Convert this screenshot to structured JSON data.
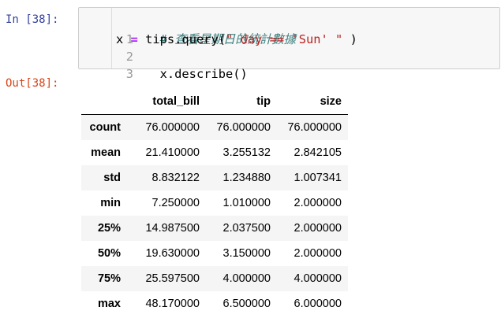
{
  "input_prompt": "In [38]:",
  "output_prompt": "Out[38]:",
  "code": {
    "line_numbers": [
      "1",
      "2",
      "3"
    ],
    "line1_comment": "# 查看星期日的統計數據",
    "line2_var": "x",
    "line2_eq": " = ",
    "line2_call": "tips.query(",
    "line2_string": "\" day == 'Sun' \"",
    "line2_close": " )",
    "line3": "x.describe()"
  },
  "table": {
    "columns": [
      "",
      "total_bill",
      "tip",
      "size"
    ],
    "rows": [
      {
        "index": "count",
        "values": [
          "76.000000",
          "76.000000",
          "76.000000"
        ]
      },
      {
        "index": "mean",
        "values": [
          "21.410000",
          "3.255132",
          "2.842105"
        ]
      },
      {
        "index": "std",
        "values": [
          "8.832122",
          "1.234880",
          "1.007341"
        ]
      },
      {
        "index": "min",
        "values": [
          "7.250000",
          "1.010000",
          "2.000000"
        ]
      },
      {
        "index": "25%",
        "values": [
          "14.987500",
          "2.037500",
          "2.000000"
        ]
      },
      {
        "index": "50%",
        "values": [
          "19.630000",
          "3.150000",
          "2.000000"
        ]
      },
      {
        "index": "75%",
        "values": [
          "25.597500",
          "4.000000",
          "4.000000"
        ]
      },
      {
        "index": "max",
        "values": [
          "48.170000",
          "6.500000",
          "6.000000"
        ]
      }
    ]
  },
  "colors": {
    "input_prompt": "#303f9f",
    "output_prompt": "#d84315",
    "cell_background": "#f7f7f7",
    "comment": "#408080",
    "string": "#ba2121",
    "operator": "#aa22ff"
  }
}
